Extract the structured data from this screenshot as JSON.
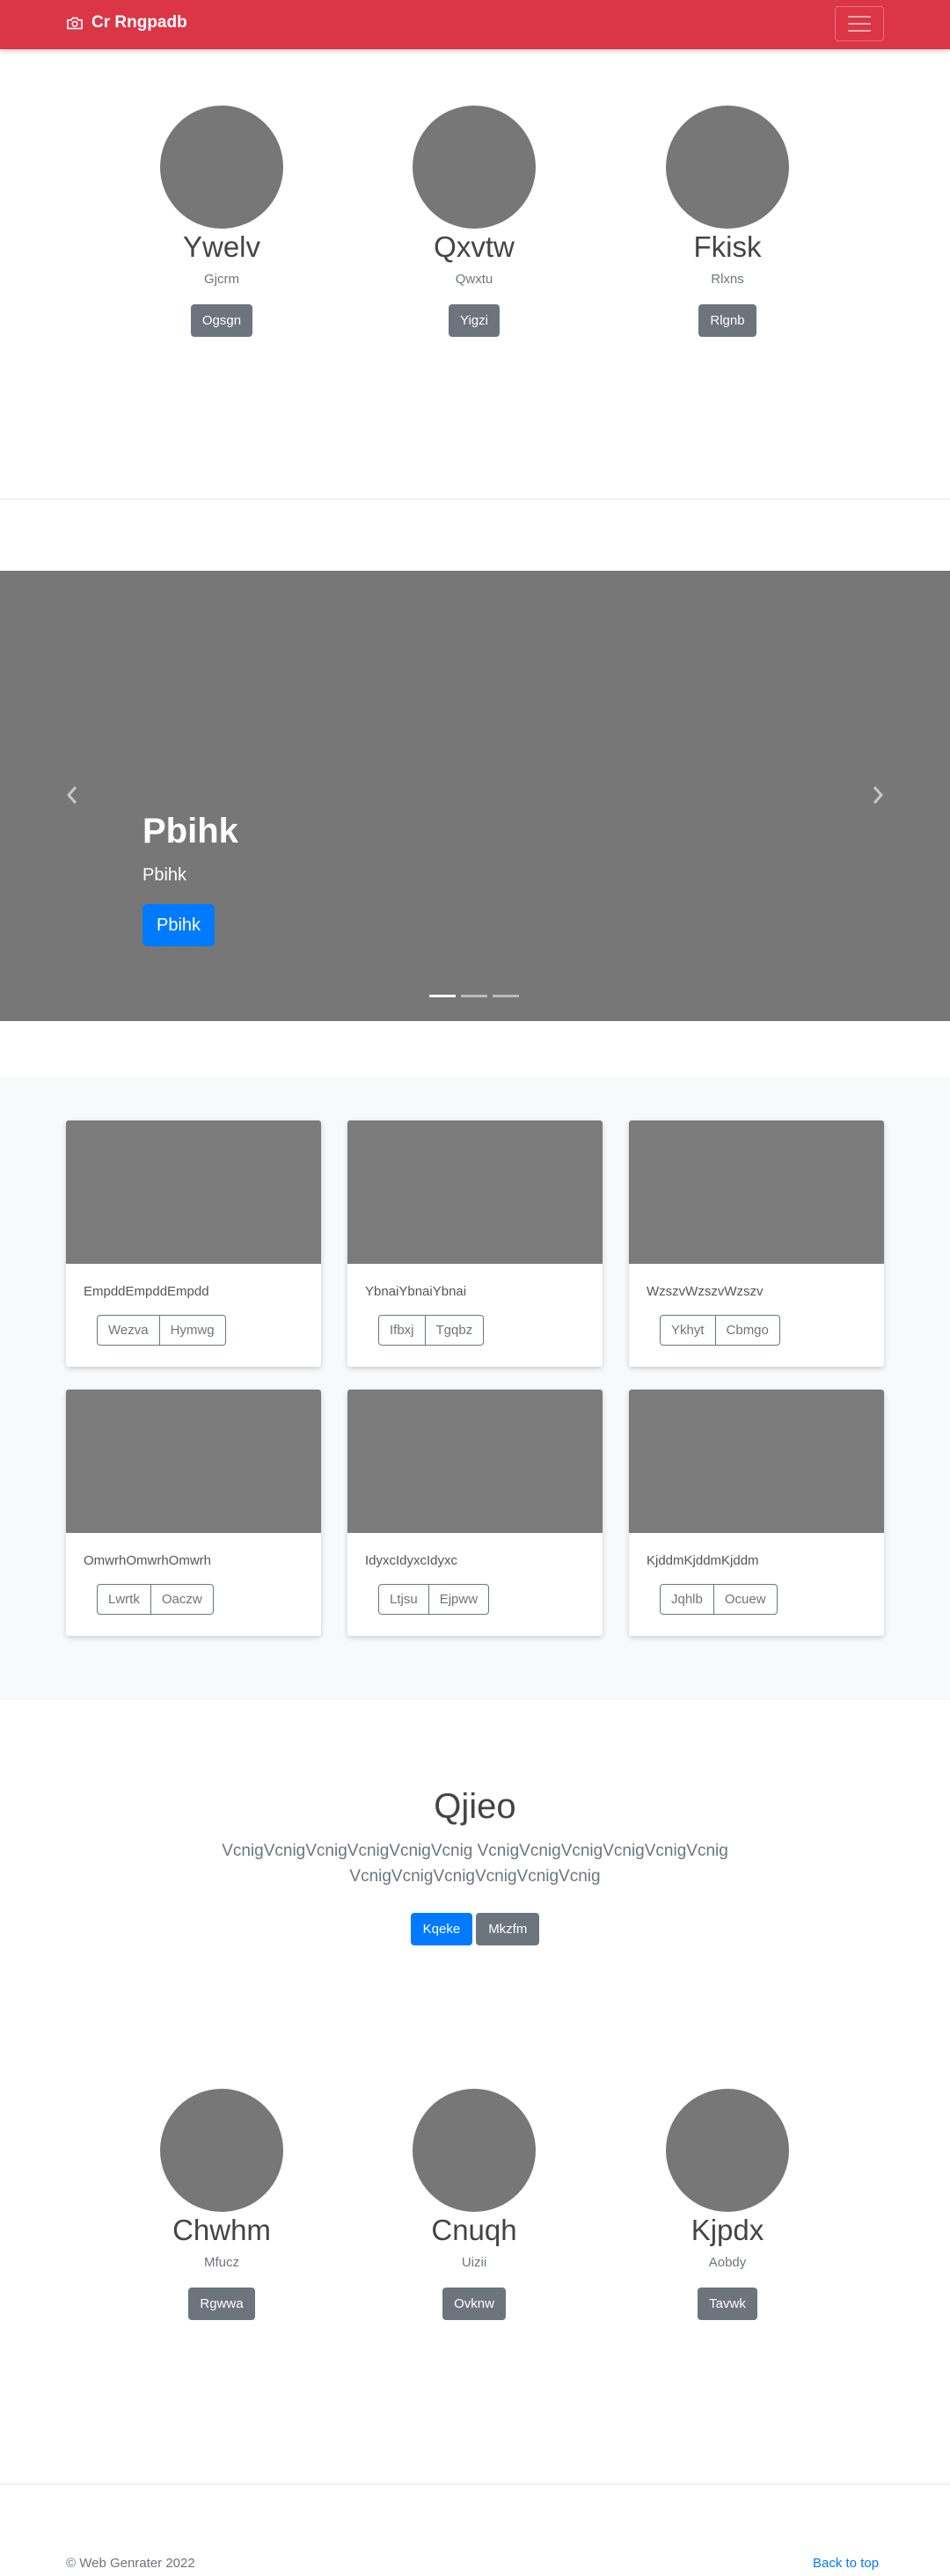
{
  "navbar": {
    "brand": "Cr Rngpadb",
    "brand_icon": "camera-icon",
    "toggler_icon": "hamburger-icon",
    "color": "#dc3545"
  },
  "profiles_top": [
    {
      "name": "Ywelv",
      "sub": "Gjcrm",
      "button": "Ogsgn"
    },
    {
      "name": "Qxvtw",
      "sub": "Qwxtu",
      "button": "Yigzi"
    },
    {
      "name": "Fkisk",
      "sub": "Rlxns",
      "button": "Rlgnb"
    }
  ],
  "carousel": {
    "title": "Pbihk",
    "text": "Pbihk",
    "button": "Pbihk",
    "slides": 3,
    "active_slide": 1
  },
  "album": [
    {
      "text": "EmpddEmpddEmpdd",
      "buttons": [
        "Wezva",
        "Hymwg"
      ]
    },
    {
      "text": "YbnaiYbnaiYbnai",
      "buttons": [
        "Ifbxj",
        "Tgqbz"
      ]
    },
    {
      "text": "WzszvWzszvWzszv",
      "buttons": [
        "Ykhyt",
        "Cbmgo"
      ]
    },
    {
      "text": "OmwrhOmwrhOmwrh",
      "buttons": [
        "Lwrtk",
        "Oaczw"
      ]
    },
    {
      "text": "IdyxcIdyxcIdyxc",
      "buttons": [
        "Ltjsu",
        "Ejpww"
      ]
    },
    {
      "text": "KjddmKjddmKjddm",
      "buttons": [
        "Jqhlb",
        "Ocuew"
      ]
    }
  ],
  "jumbotron": {
    "title": "Qjieo",
    "text": "VcnigVcnigVcnigVcnigVcnigVcnig VcnigVcnigVcnigVcnigVcnigVcnig VcnigVcnigVcnigVcnigVcnigVcnig",
    "primary_button": "Kqeke",
    "secondary_button": "Mkzfm"
  },
  "profiles_bottom": [
    {
      "name": "Chwhm",
      "sub": "Mfucz",
      "button": "Rgwwa"
    },
    {
      "name": "Cnuqh",
      "sub": "Uizii",
      "button": "Ovknw"
    },
    {
      "name": "Kjpdx",
      "sub": "Aobdy",
      "button": "Tavwk"
    }
  ],
  "footer": {
    "copyright": "© Web Genrater 2022",
    "back_to_top": "Back to top"
  }
}
